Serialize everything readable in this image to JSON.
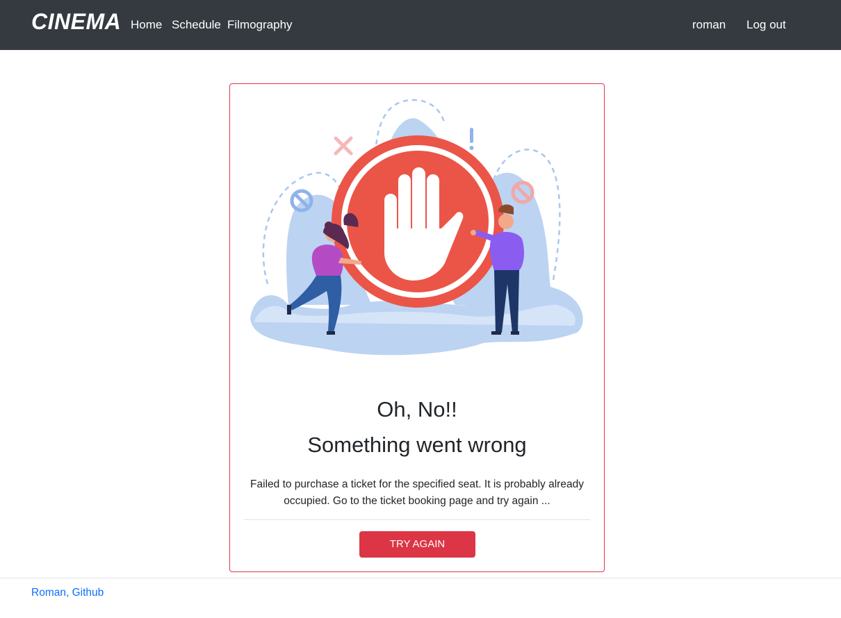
{
  "navbar": {
    "brand": "CINEMA",
    "links": [
      "Home",
      "Schedule",
      "Filmography"
    ],
    "user": "roman",
    "logout": "Log out"
  },
  "card": {
    "title_line1": "Oh, No!!",
    "title_line2": "Something went wrong",
    "message": "Failed to purchase a ticket for the specified seat. It is probably already occupied. Go to the ticket booking page and try again ...",
    "button_label": "TRY AGAIN"
  },
  "footer": {
    "link": "Roman, Github"
  },
  "colors": {
    "navbar_bg": "#343a40",
    "danger": "#dc3545",
    "link": "#0d6efd",
    "stop_sign": "#ea5548"
  }
}
